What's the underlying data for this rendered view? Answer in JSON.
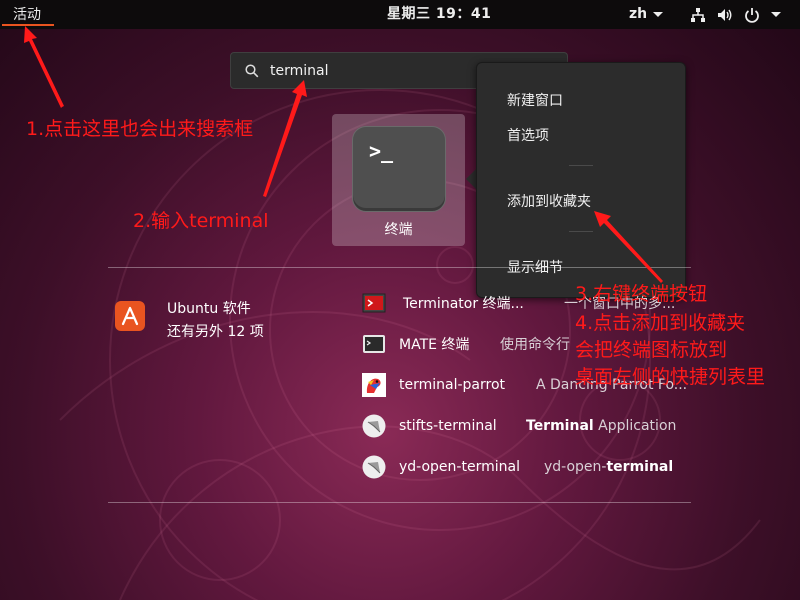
{
  "topbar": {
    "activities": "活动",
    "clock": "星期三 19：41",
    "language": "zh",
    "icons": [
      "network-icon",
      "volume-icon",
      "power-icon"
    ]
  },
  "search": {
    "icon": "search-icon",
    "value": "terminal"
  },
  "app": {
    "label": "终端",
    "prompt": ">_"
  },
  "context_menu": {
    "items": [
      "新建窗口",
      "首选项",
      "添加到收藏夹",
      "显示细节"
    ]
  },
  "provider": {
    "name": "Ubuntu 软件",
    "more": "还有另外 12 项"
  },
  "results": [
    {
      "name": "Terminator 终端...",
      "desc": "一个窗口中的多..."
    },
    {
      "name": "MATE 终端",
      "desc": "使用命令行"
    },
    {
      "name": "terminal-parrot",
      "desc": "A Dancing Parrot Fo..."
    },
    {
      "name": "stifts-terminal",
      "desc_bold": "Terminal",
      "desc_rest": " Application"
    },
    {
      "name": "yd-open-terminal",
      "desc_pre": "yd-open-",
      "desc_bold": "terminal"
    }
  ],
  "annotations": {
    "step1": "1.点击这里也会出来搜索框",
    "step2": "2.输入terminal",
    "step3": "3.右键终端按钮",
    "step4_line1": "4.点击添加到收藏夹",
    "step4_line2": "会把终端图标放到",
    "step4_line3": "桌面左侧的快捷列表里"
  },
  "colors": {
    "accent": "#e95420",
    "annotation": "#ff1a1a",
    "topbar": "#0d0b0c"
  }
}
